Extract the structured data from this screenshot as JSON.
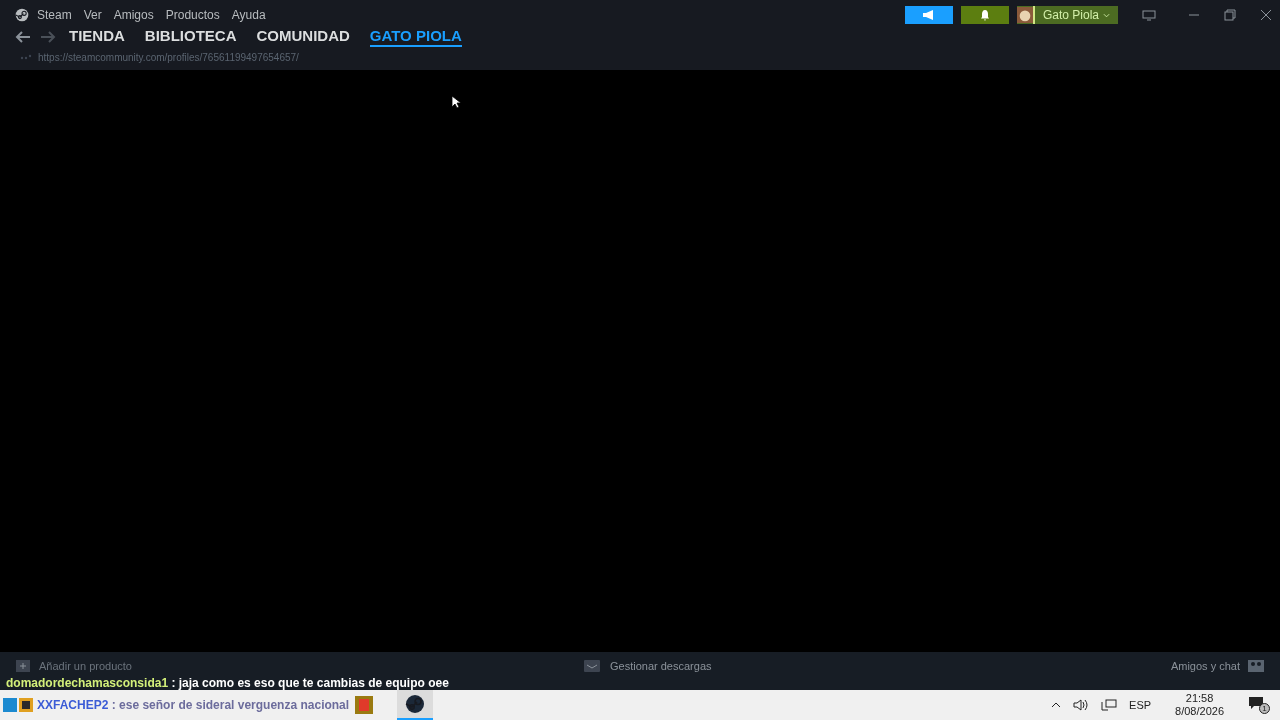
{
  "menu": [
    "Steam",
    "Ver",
    "Amigos",
    "Productos",
    "Ayuda"
  ],
  "account": {
    "name": "Gato Piola"
  },
  "tabs": [
    {
      "label": "TIENDA",
      "selected": false
    },
    {
      "label": "BIBLIOTECA",
      "selected": false
    },
    {
      "label": "COMUNIDAD",
      "selected": false
    },
    {
      "label": "GATO PIOLA",
      "selected": true
    }
  ],
  "url": "https://steamcommunity.com/profiles/76561199497654657/",
  "bottom_bar": {
    "add": "Añadir un producto",
    "downloads": "Gestionar descargas",
    "friends": "Amigos y chat"
  },
  "chat": [
    {
      "user": "domadordechamasconsida1",
      "message": ": jaja como es eso que te cambias de equipo oee"
    },
    {
      "user": "XXFACHEP2",
      "message": ": ese señor de sideral verguenza nacional"
    }
  ],
  "taskbar": {
    "language": "ESP",
    "time": "21:58",
    "date": "8/08/2026",
    "notifications": "1"
  }
}
